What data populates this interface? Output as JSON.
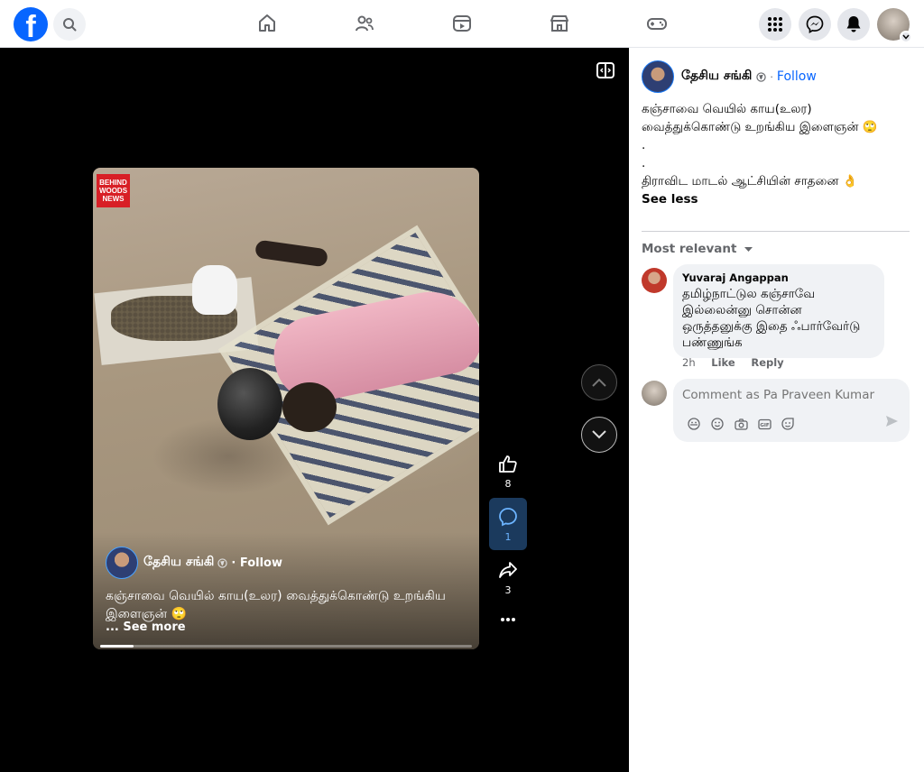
{
  "topbar": {
    "logo": "f",
    "icons": [
      "facebook-logo",
      "search-icon",
      "home-icon",
      "friends-icon",
      "video-icon",
      "marketplace-icon",
      "gaming-icon",
      "menu-grid-icon",
      "messenger-icon",
      "notifications-icon"
    ]
  },
  "video": {
    "badge": "BEHIND WOODS NEWS",
    "author": "தேசிய சங்கி",
    "follow": "· Follow",
    "caption": "கஞ்சாவை வெயில் காய(உலர) வைத்துக்கொண்டு உறங்கிய இளைஞன் 🙄",
    "see_more": "... See more",
    "progress_fraction": 0.09,
    "likes": "8",
    "comments": "1",
    "shares": "3"
  },
  "post": {
    "author": "தேசிய சங்கி",
    "follow": "Follow",
    "text_line1": "கஞ்சாவை வெயில் காய(உலர) வைத்துக்கொண்டு உறங்கிய இளைஞன் 🙄",
    "dot1": ".",
    "dot2": ".",
    "text_line2": "திராவிட மாடல் ஆட்சியின் சாதனை 👌",
    "see_less": "See less"
  },
  "comments": {
    "sort_label": "Most relevant",
    "items": [
      {
        "name": "Yuvaraj Angappan",
        "text": "தமிழ்நாட்டுல கஞ்சாவே இல்லைன்னு சொன்ன ஒருத்தனுக்கு இதை ஃபார்வேர்டு பண்ணுங்க",
        "time": "2h",
        "like": "Like",
        "reply": "Reply"
      }
    ],
    "compose_placeholder": "Comment as Pa Praveen Kumar"
  }
}
